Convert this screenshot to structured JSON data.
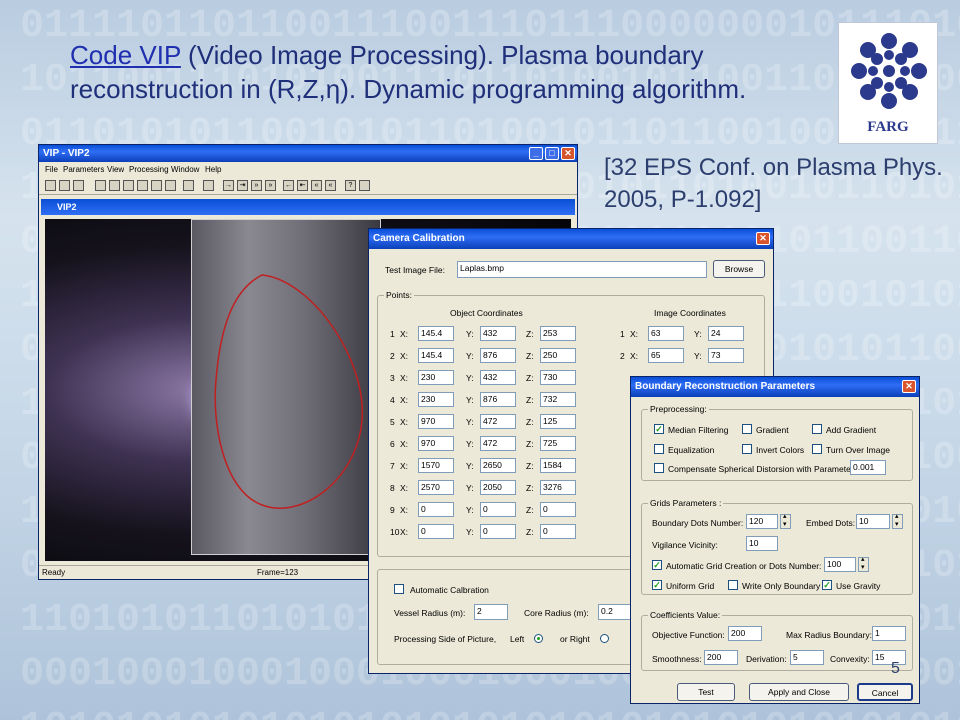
{
  "slide": {
    "title_link": "Code VIP",
    "title_rest": " (Video Image Processing). Plasma boundary reconstruction in (R,Z,η). Dynamic programming algorithm.",
    "reference": "[32 EPS Conf. on Plasma Phys. 2005, P-1.092]",
    "logo_text": "FARG",
    "page_number": "5"
  },
  "vip_window": {
    "title": "VIP - VIP2",
    "menu": [
      "File",
      "Parameters",
      "View",
      "Processing",
      "Window",
      "Help"
    ],
    "child_title": "VIP2",
    "status_left": "Ready",
    "status_frame": "Frame=123"
  },
  "camera": {
    "title": "Camera Calibration",
    "test_image_label": "Test Image File:",
    "test_image_value": "Laplas.bmp",
    "browse": "Browse",
    "points_label": "Points:",
    "object_coords": "Object Coordinates",
    "image_coords": "Image Coordinates",
    "rows": [
      {
        "n": "1",
        "x": "145.4",
        "y": "432",
        "z": "253",
        "ix": "63",
        "iy": "24"
      },
      {
        "n": "2",
        "x": "145.4",
        "y": "876",
        "z": "250",
        "ix": "65",
        "iy": "73"
      },
      {
        "n": "3",
        "x": "230",
        "y": "432",
        "z": "730"
      },
      {
        "n": "4",
        "x": "230",
        "y": "876",
        "z": "732"
      },
      {
        "n": "5",
        "x": "970",
        "y": "472",
        "z": "125"
      },
      {
        "n": "6",
        "x": "970",
        "y": "472",
        "z": "725"
      },
      {
        "n": "7",
        "x": "1570",
        "y": "2650",
        "z": "1584"
      },
      {
        "n": "8",
        "x": "2570",
        "y": "2050",
        "z": "3276"
      },
      {
        "n": "9",
        "x": "0",
        "y": "0",
        "z": "0"
      },
      {
        "n": "10",
        "x": "0",
        "y": "0",
        "z": "0"
      }
    ],
    "auto_calibration": "Automatic Calbration",
    "vessel_radius_label": "Vessel Radius (m):",
    "vessel_radius_value": "2",
    "core_radius_label": "Core Radius (m):",
    "core_radius_value": "0.2",
    "side_label": "Processing Side of Picture,",
    "side_left": "Left",
    "side_right": "or Right"
  },
  "brp": {
    "title": "Boundary Reconstruction Parameters",
    "preprocessing": "Preprocessing:",
    "median": "Median Filtering",
    "gradient": "Gradient",
    "add_gradient": "Add Gradient",
    "equalization": "Equalization",
    "invert": "Invert Colors",
    "turn_over": "Turn Over Image",
    "compensate": "Compensate Spherical Distorsion with Parameter:",
    "compensate_value": "0.001",
    "grids": "Grids Parameters :",
    "boundary_dots": "Boundary Dots Number:",
    "boundary_dots_value": "120",
    "embed_dots": "Embed Dots:",
    "embed_dots_value": "10",
    "vigilance": "Vigilance Vicinity:",
    "vigilance_value": "10",
    "auto_grid": "Automatic Grid Creation or Dots Number:",
    "auto_grid_value": "100",
    "uniform_grid": "Uniform Grid",
    "write_only": "Write Only Boundary",
    "use_gravity": "Use Gravity",
    "coefficients": "Coefficients Value:",
    "objective": "Objective Function:",
    "objective_value": "200",
    "max_radius": "Max Radius Boundary:",
    "max_radius_value": "1",
    "smoothness": "Smoothness:",
    "smoothness_value": "200",
    "derivation": "Derivation:",
    "derivation_value": "5",
    "convexity": "Convexity:",
    "convexity_value": "15",
    "test": "Test",
    "apply_close": "Apply and Close",
    "cancel": "Cancel"
  }
}
